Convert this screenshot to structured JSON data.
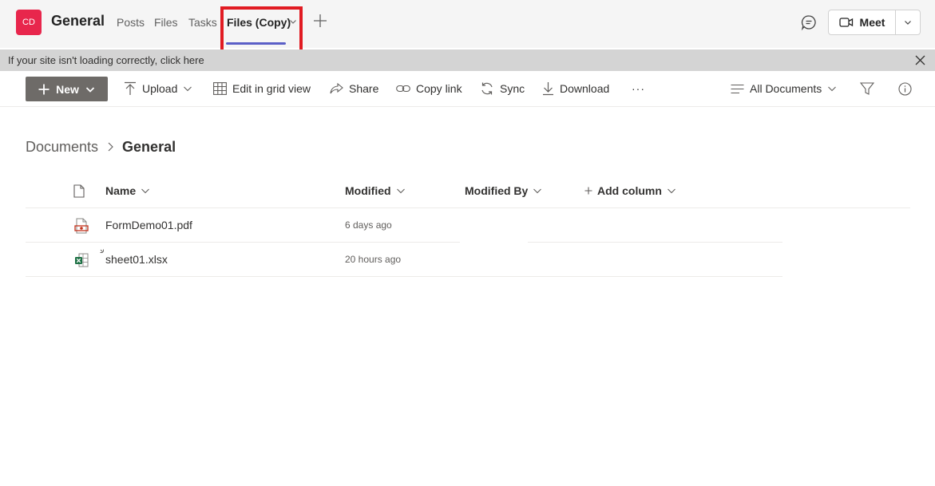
{
  "theme": {
    "accent": "#5b5fc7",
    "avatar_bg": "#e8264c",
    "highlight": "#e11b22",
    "new_bg": "#6e6b68",
    "pdf_color": "#c4311b",
    "excel_color": "#1e7145"
  },
  "header": {
    "avatar_initials": "CD",
    "channel_title": "General",
    "tabs": [
      {
        "label": "Posts"
      },
      {
        "label": "Files"
      },
      {
        "label": "Tasks"
      },
      {
        "label": "Files (Copy)",
        "active": true
      }
    ],
    "add_tab_icon": "plus-icon",
    "chat_icon": "chat-icon",
    "meet": {
      "label": "Meet",
      "icon": "video-camera-icon",
      "dropdown_icon": "chevron-down-icon"
    }
  },
  "notice": {
    "text": "If your site isn't loading correctly, click here",
    "close_icon": "close-icon"
  },
  "command_bar": {
    "new_label": "New",
    "upload_label": "Upload",
    "grid_label": "Edit in grid view",
    "share_label": "Share",
    "copy_link_label": "Copy link",
    "sync_label": "Sync",
    "download_label": "Download",
    "more_label": "···",
    "view_label": "All Documents",
    "filter_icon": "filter-icon",
    "info_icon": "info-icon"
  },
  "breadcrumb": {
    "root": "Documents",
    "current": "General"
  },
  "list": {
    "columns": {
      "name": "Name",
      "modified": "Modified",
      "modified_by": "Modified By",
      "add_column": "Add column"
    },
    "rows": [
      {
        "name": "FormDemo01.pdf",
        "modified": "6 days ago",
        "icon": "pdf-file-icon"
      },
      {
        "name": "sheet01.xlsx",
        "modified": "20 hours ago",
        "icon": "excel-file-icon"
      }
    ]
  }
}
